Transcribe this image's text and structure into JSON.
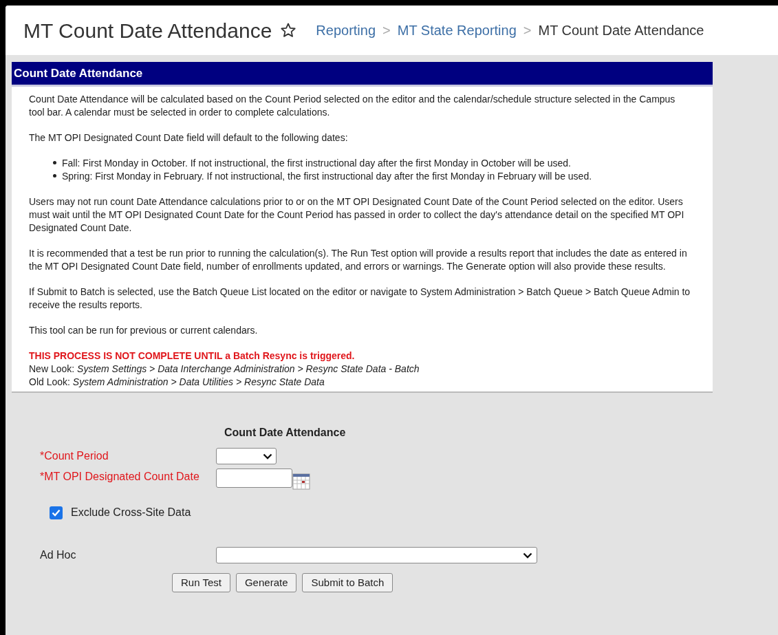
{
  "header": {
    "title": "MT Count Date Attendance",
    "favorite": false,
    "breadcrumbs": [
      {
        "label": "Reporting",
        "link": true
      },
      {
        "label": "MT State Reporting",
        "link": true
      },
      {
        "label": "MT Count Date Attendance",
        "link": false
      }
    ],
    "separator": ">"
  },
  "info": {
    "title": "Count Date Attendance",
    "blocks": [
      {
        "kind": "paragraph",
        "text": "Count Date Attendance will be calculated based on the Count Period selected on the editor and the calendar/schedule structure selected in the Campus tool bar. A calendar must be selected in order to complete calculations."
      },
      {
        "kind": "paragraph",
        "text": "The MT OPI Designated Count Date field will default to the following dates:"
      },
      {
        "kind": "bullets",
        "items": [
          "Fall: First Monday in October. If not instructional, the first instructional day after the first Monday in October will be used.",
          "Spring: First Monday in February. If not instructional, the first instructional day after the first Monday in February will be used."
        ]
      },
      {
        "kind": "paragraph",
        "text": "Users may not run count Date Attendance calculations prior to or on the MT OPI Designated Count Date of the Count Period selected on the editor. Users must wait until the MT OPI Designated Count Date for the Count Period has passed in order to collect the day's attendance detail on the specified MT OPI Designated Count Date."
      },
      {
        "kind": "paragraph",
        "text": "It is recommended that a test be run prior to running the calculation(s). The Run Test option will provide a results report that includes the date as entered in the MT OPI Designated Count Date field, number of enrollments updated, and errors or warnings. The Generate option will also provide these results."
      },
      {
        "kind": "paragraph",
        "text": "If Submit to Batch is selected, use the Batch Queue List located on the editor or navigate to System Administration > Batch Queue > Batch Queue Admin to receive the results reports."
      },
      {
        "kind": "paragraph",
        "text": "This tool can be run for previous or current calendars."
      },
      {
        "kind": "notice",
        "warning": "THIS PROCESS IS NOT COMPLETE UNTIL a Batch Resync is triggered.",
        "lines": [
          "New Look: *System Settings > Data Interchange Administration > Resync State Data - Batch*",
          "Old Look: *System Administration > Data Utilities > Resync State Data*"
        ]
      }
    ]
  },
  "form": {
    "title": "Count Date Attendance",
    "fields": [
      {
        "kind": "select",
        "label": "*Count Period",
        "required": true
      },
      {
        "kind": "date",
        "label": "*MT OPI Designated Count Date",
        "required": true
      }
    ],
    "checkbox": {
      "label": "Exclude Cross-Site Data",
      "checked": true
    },
    "ad_hoc": {
      "label": "Ad Hoc",
      "required": false
    },
    "buttons": [
      "Run Test",
      "Generate",
      "Submit to Batch"
    ]
  }
}
